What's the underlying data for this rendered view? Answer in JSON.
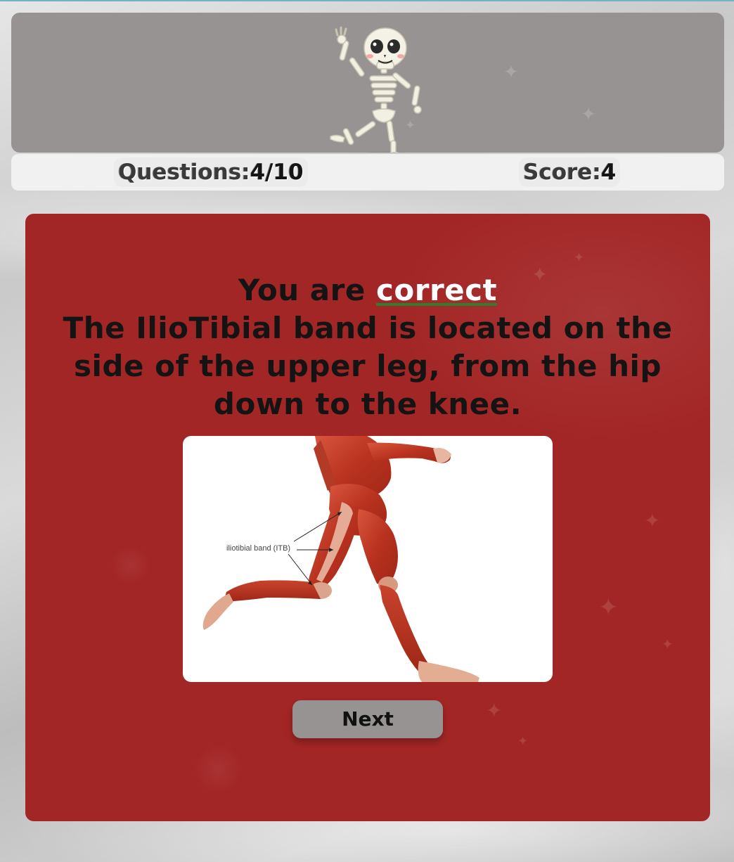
{
  "stats": {
    "questions_label": "Questions:",
    "questions_value": "4/10",
    "score_label": "Score:",
    "score_value": "4"
  },
  "feedback": {
    "prefix": "You are ",
    "verdict": "correct",
    "explanation": "The IlioTibial band is located on the side of the upper leg, from the hip down to the knee."
  },
  "illustration": {
    "label": "iliotibial band (ITB)",
    "icon": "running-leg-muscle-anatomy"
  },
  "banner": {
    "icon": "dancing-skeleton-icon"
  },
  "next_button": {
    "label": "Next"
  },
  "colors": {
    "card_background": "#a32626",
    "banner_background": "#989393",
    "verdict_underline": "#2f7d2f"
  }
}
